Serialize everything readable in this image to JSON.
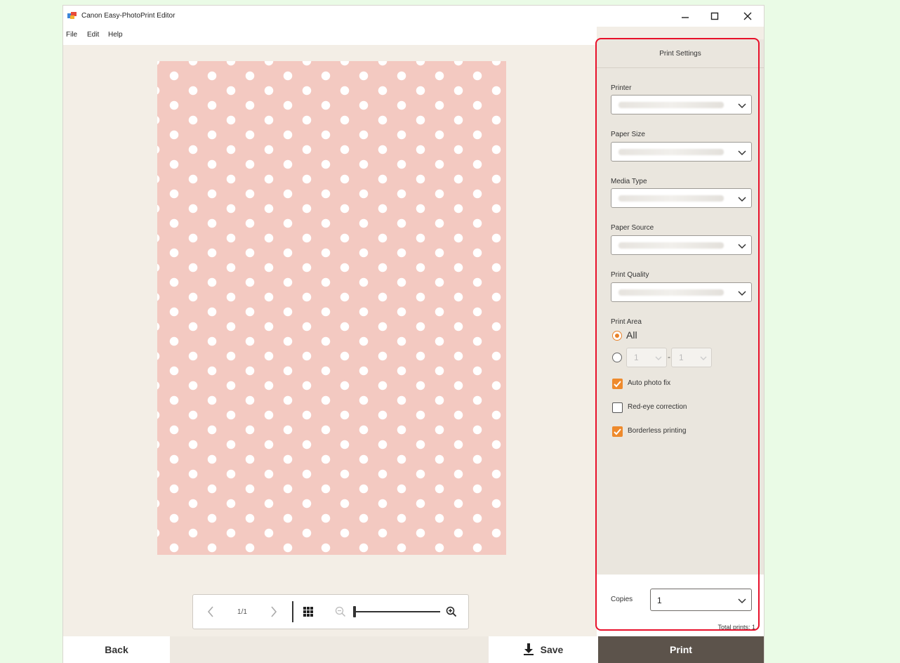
{
  "window": {
    "title": "Canon Easy-PhotoPrint Editor",
    "controls": [
      "minimize",
      "maximize",
      "close"
    ]
  },
  "menu": [
    "File",
    "Edit",
    "Help"
  ],
  "preview_nav": {
    "page_indicator": "1/1",
    "icons": [
      "chevron-left-icon",
      "chevron-right-icon",
      "grid-icon",
      "zoom-out-icon",
      "zoom-in-icon"
    ],
    "zoom_level": 0.0
  },
  "print_settings": {
    "header": "Print Settings",
    "fields": [
      {
        "label": "Printer",
        "value": ""
      },
      {
        "label": "Paper Size",
        "value": ""
      },
      {
        "label": "Media Type",
        "value": ""
      },
      {
        "label": "Paper Source",
        "value": ""
      },
      {
        "label": "Print Quality",
        "value": ""
      }
    ],
    "print_area": {
      "label": "Print Area",
      "option_all": "All",
      "range_from": "1",
      "range_sep": "-",
      "range_to": "1",
      "selected": "All"
    },
    "checkboxes": [
      {
        "label": "Auto photo fix",
        "checked": true
      },
      {
        "label": "Red-eye correction",
        "checked": false
      },
      {
        "label": "Borderless printing",
        "checked": true
      }
    ],
    "copies_label": "Copies",
    "copies_value": "1",
    "total_prints": "Total prints: 1"
  },
  "bottom": {
    "back_label": "Back",
    "save_label": "Save",
    "print_label": "Print"
  },
  "colors": {
    "accent": "#ee8a2c",
    "highlight_border": "#e8102a",
    "page_fill": "#f3c9c1",
    "print_button": "#5c534b"
  }
}
